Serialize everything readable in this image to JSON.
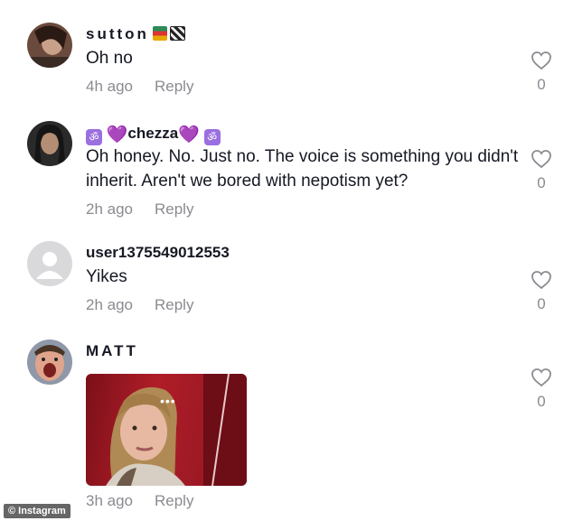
{
  "comments": [
    {
      "username": "sutton",
      "text": "Oh no",
      "time": "4h ago",
      "reply_label": "Reply",
      "likes": "0",
      "badges": [
        "books-emoji",
        "clapper-emoji"
      ]
    },
    {
      "username": "chezza",
      "text": "Oh honey. No. Just no. The voice is something you didn't inherit. Aren't we bored with nepotism yet?",
      "time": "2h ago",
      "reply_label": "Reply",
      "likes": "0",
      "badges": [
        "om-emoji",
        "purple-heart-emoji"
      ]
    },
    {
      "username": "user1375549012553",
      "text": "Yikes",
      "time": "2h ago",
      "reply_label": "Reply",
      "likes": "0"
    },
    {
      "username": "MATT",
      "text": "",
      "time": "3h ago",
      "reply_label": "Reply",
      "likes": "0",
      "attachment": "gif",
      "gif_overlay": "•••"
    }
  ],
  "symbols": {
    "om": "ॐ",
    "heart": "💜"
  },
  "watermark": "© Instagram",
  "colors": {
    "text": "#161823",
    "meta": "#8a8b91",
    "emoji_purple": "#9a6fe0"
  }
}
